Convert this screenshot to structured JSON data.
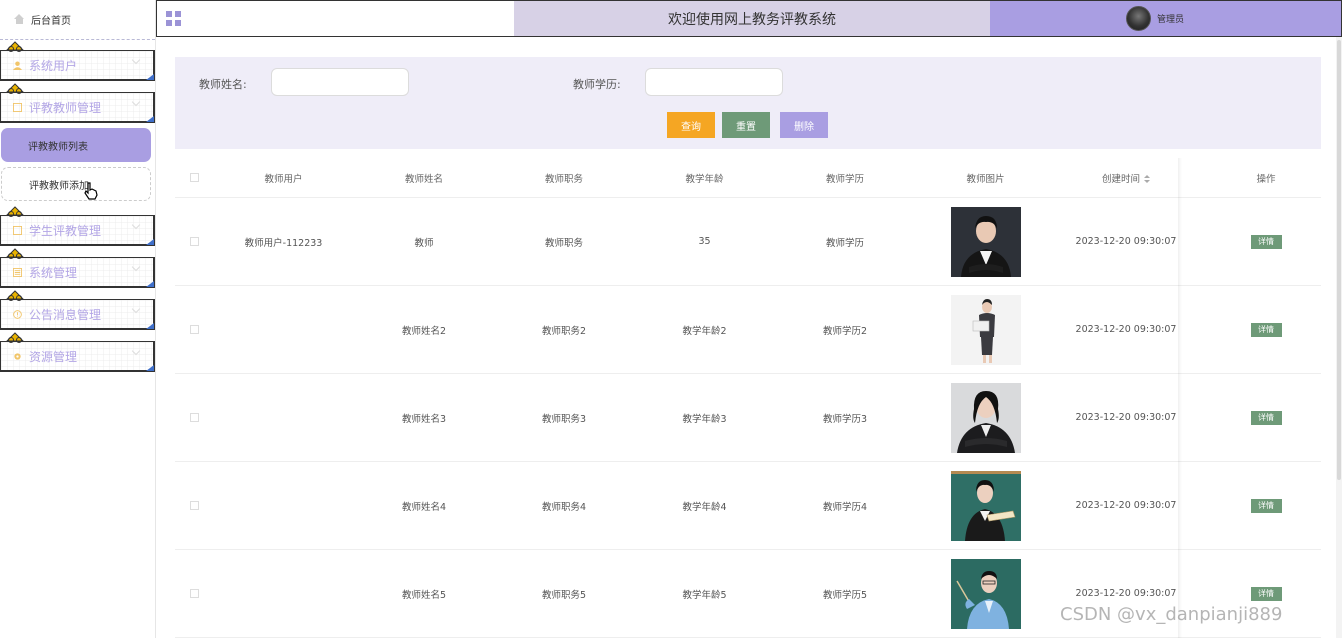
{
  "sidebar": {
    "home_label": "后台首页",
    "menus": [
      {
        "label": "系统用户"
      },
      {
        "label": "评教教师管理"
      },
      {
        "label": "学生评教管理"
      },
      {
        "label": "系统管理"
      },
      {
        "label": "公告消息管理"
      },
      {
        "label": "资源管理"
      }
    ],
    "sub_items": [
      {
        "label": "评教教师列表",
        "active": true
      },
      {
        "label": "评教教师添加",
        "active": false
      }
    ]
  },
  "header": {
    "title": "欢迎使用网上教务评教系统",
    "user": "管理员"
  },
  "search": {
    "name_label": "教师姓名:",
    "edu_label": "教师学历:",
    "name_value": "",
    "edu_value": "",
    "query_label": "查询",
    "reset_label": "重置",
    "delete_label": "删除"
  },
  "table": {
    "headers": [
      "教师用户",
      "教师姓名",
      "教师职务",
      "教学年龄",
      "教师学历",
      "教师图片",
      "创建时间",
      "操作"
    ],
    "rows": [
      {
        "user": "教师用户-112233",
        "name": "教师",
        "duty": "教师职务",
        "age": "35",
        "edu": "教师学历",
        "time": "2023-12-20 09:30:07",
        "action": "详情"
      },
      {
        "user": "",
        "name": "教师姓名2",
        "duty": "教师职务2",
        "age": "教学年龄2",
        "edu": "教师学历2",
        "time": "2023-12-20 09:30:07",
        "action": "详情"
      },
      {
        "user": "",
        "name": "教师姓名3",
        "duty": "教师职务3",
        "age": "教学年龄3",
        "edu": "教师学历3",
        "time": "2023-12-20 09:30:07",
        "action": "详情"
      },
      {
        "user": "",
        "name": "教师姓名4",
        "duty": "教师职务4",
        "age": "教学年龄4",
        "edu": "教师学历4",
        "time": "2023-12-20 09:30:07",
        "action": "详情"
      },
      {
        "user": "",
        "name": "教师姓名5",
        "duty": "教师职务5",
        "age": "教学年龄5",
        "edu": "教师学历5",
        "time": "2023-12-20 09:30:07",
        "action": "详情"
      }
    ]
  },
  "watermark": "CSDN @vx_danpianji889",
  "colors": {
    "accent": "#a99ee2",
    "header_mid": "#d7d1e6",
    "query": "#f5a623",
    "reset": "#6e9a78",
    "detail": "#6e9a78",
    "menu_text": "#b3a6e6"
  }
}
